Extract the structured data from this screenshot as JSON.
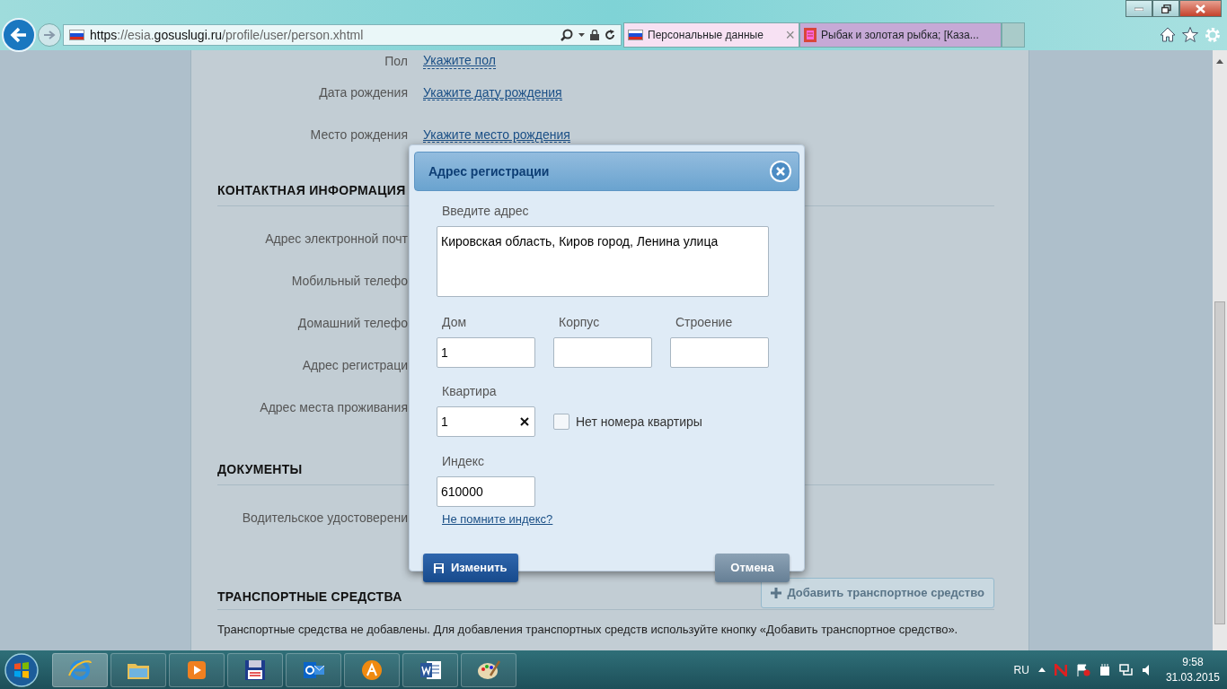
{
  "browser": {
    "address": [
      {
        "text": "https",
        "strong": true
      },
      {
        "text": "://esia.",
        "strong": false
      },
      {
        "text": "gosuslugi.ru",
        "strong": true
      },
      {
        "text": "/profile/user/person.xhtml",
        "strong": false
      }
    ],
    "tabs": [
      {
        "title": "Персональные данные",
        "selected": true,
        "close": "×"
      },
      {
        "title": "Рыбак и золотая рыбка; [Каза...",
        "selected": false
      }
    ]
  },
  "profile": {
    "rows": [
      {
        "label": "Пол",
        "value": "Укажите пол"
      },
      {
        "label": "Дата рождения",
        "value": "Укажите дату рождения"
      },
      {
        "label": "Место рождения",
        "value": "Укажите место рождения"
      }
    ],
    "sections": [
      {
        "title": "КОНТАКТНАЯ ИНФОРМАЦИЯ",
        "rows": [
          "Адрес электронной почт",
          "Мобильный телефо",
          "Домашний телефо",
          "Адрес регистраци",
          "Адрес места проживания"
        ]
      },
      {
        "title": "ДОКУМЕНТЫ",
        "rows": [
          "Водительское удостоверени"
        ]
      },
      {
        "title": "ТРАНСПОРТНЫЕ СРЕДСТВА",
        "button": "Добавить транспортное средство",
        "note": "Транспортные средства не добавлены. Для добавления транспортных средств используйте кнопку «Добавить транспортное средство»."
      }
    ]
  },
  "dialog": {
    "title": "Адрес регистрации",
    "address_label": "Введите адрес",
    "address": "Кировская область, Киров город, Ленина улица",
    "house_fields": [
      {
        "label": "Дом",
        "value": "1"
      },
      {
        "label": "Корпус"
      },
      {
        "label": "Строение"
      }
    ],
    "flat_label": "Квартира",
    "flat": "1",
    "no_flat": {
      "label": "Нет номера квартиры",
      "checked": false
    },
    "index_label": "Индекс",
    "index": "610000",
    "index_link": "Не помните индекс?",
    "save": "Изменить",
    "cancel": "Отмена"
  },
  "taskbar": {
    "apps": [
      {
        "kind": "ie",
        "selected": true
      },
      {
        "kind": "folder",
        "selected": false
      },
      {
        "kind": "player",
        "selected": false
      },
      {
        "kind": "floppy",
        "selected": false
      },
      {
        "kind": "outlook",
        "selected": false
      },
      {
        "kind": "orange",
        "selected": false
      },
      {
        "kind": "word",
        "selected": false
      },
      {
        "kind": "paint",
        "selected": false
      }
    ],
    "language": "RU",
    "time": "9:58",
    "date": "31.03.2015"
  }
}
